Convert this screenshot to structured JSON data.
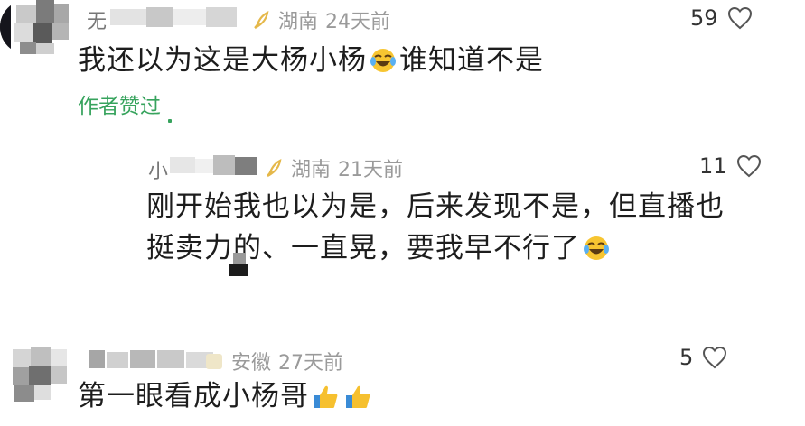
{
  "comments": [
    {
      "name_visible": "无",
      "badge_icon": "feather-badge-icon",
      "location": "湖南",
      "time": "24天前",
      "likes": "59",
      "text_before": "我还以为这是大杨小杨",
      "text_after": "谁知道不是",
      "author_liked": "作者赞过"
    },
    {
      "name_visible": "小",
      "badge_icon": "feather-badge-icon",
      "location": "湖南",
      "time": "21天前",
      "likes": "11",
      "line1": "刚开始我也以为是，后来发现不是，但直播也",
      "line2": "挺卖力的、一直晃，要我早不行了"
    },
    {
      "badge_icon": "level-badge-icon",
      "location": "安徽",
      "time": "27天前",
      "likes": "5",
      "text": "第一眼看成小杨哥"
    }
  ],
  "colors": {
    "accent_green": "#37a35d",
    "meta_gray": "#9a9a9a",
    "text": "#1d1d1d",
    "badge_gold": "#e5b84a"
  }
}
